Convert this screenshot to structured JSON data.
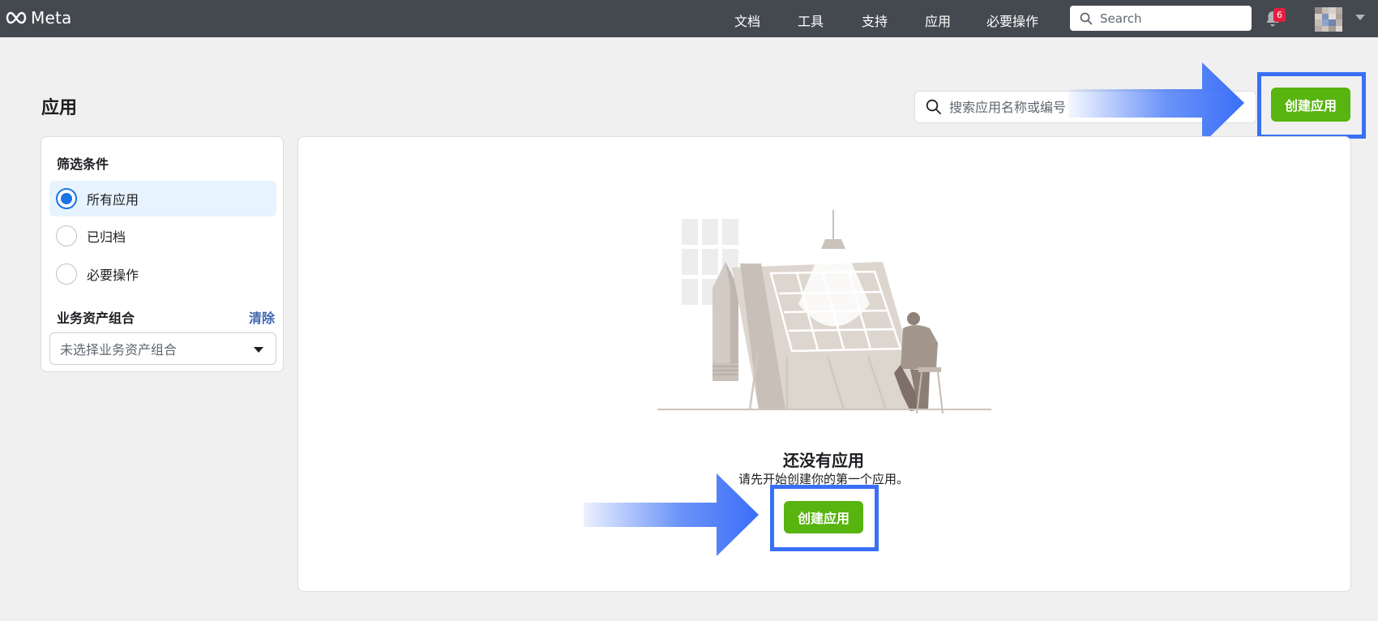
{
  "nav": {
    "brand": "Meta",
    "items": [
      "文档",
      "工具",
      "支持",
      "应用",
      "必要操作"
    ],
    "search_placeholder": "Search",
    "notification_count": "6"
  },
  "page": {
    "title": "应用",
    "search_placeholder": "搜索应用名称或编号",
    "create_button": "创建应用"
  },
  "filters": {
    "heading": "筛选条件",
    "options": [
      {
        "label": "所有应用",
        "selected": true
      },
      {
        "label": "已归档",
        "selected": false
      },
      {
        "label": "必要操作",
        "selected": false
      }
    ],
    "business_label": "业务资产组合",
    "clear_label": "清除",
    "business_placeholder": "未选择业务资产组合"
  },
  "empty_state": {
    "title": "还没有应用",
    "subtitle": "请先开始创建你的第一个应用。",
    "create_button": "创建应用"
  },
  "colors": {
    "topbar": "#444950",
    "accent_green": "#58b40e",
    "highlight_blue": "#3a6ff7",
    "link_blue": "#4267b2",
    "badge_red": "#e41e3f"
  }
}
